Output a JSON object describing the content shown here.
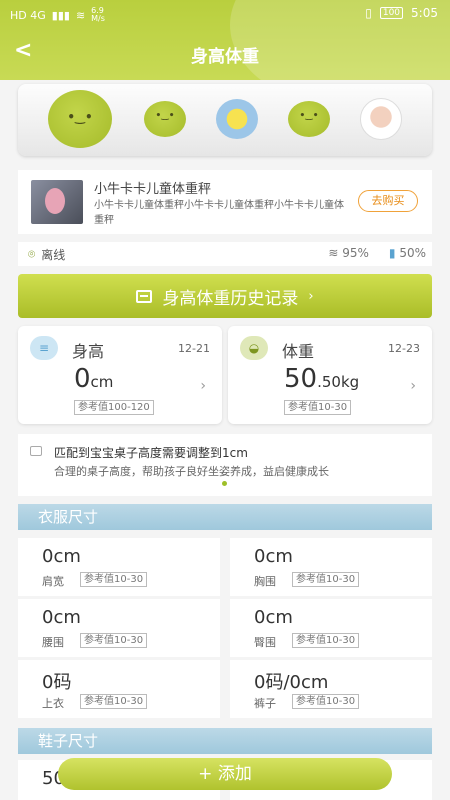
{
  "status_bar": {
    "network": "HD 4G",
    "speed_value": "6.9",
    "speed_unit": "M/s",
    "battery": "100",
    "time": "5:05"
  },
  "header": {
    "back_icon": "chevron-left-icon",
    "title": "身高体重"
  },
  "profiles": [
    "avatar-green-face-large",
    "avatar-green-face",
    "avatar-spongebob",
    "avatar-green-face",
    "avatar-girl-photo"
  ],
  "device": {
    "name": "小牛卡卡儿童体重秤",
    "desc": "小牛卡卡儿童体重秤小牛卡卡儿童体重秤小牛卡卡儿童体重秤",
    "buy_label": "去购买"
  },
  "connection": {
    "status": "离线",
    "wifi": "95%",
    "battery": "50%"
  },
  "history_button": "身高体重历史记录",
  "height": {
    "label": "身高",
    "date": "12-21",
    "value": "0",
    "unit": "cm",
    "ref": "参考值100-120"
  },
  "weight": {
    "label": "体重",
    "date": "12-23",
    "value": "50",
    "decimal": ".50",
    "unit": "kg",
    "ref": "参考值10-30"
  },
  "tip": {
    "title": "匹配到宝宝桌子高度需要调整到1cm",
    "text": "合理的桌子高度，帮助孩子良好坐姿养成，益启健康成长"
  },
  "clothes": {
    "title": "衣服尺寸",
    "items": [
      {
        "value": "0cm",
        "label": "肩宽",
        "ref": "参考值10-30"
      },
      {
        "value": "0cm",
        "label": "胸围",
        "ref": "参考值10-30"
      },
      {
        "value": "0cm",
        "label": "腰围",
        "ref": "参考值10-30"
      },
      {
        "value": "0cm",
        "label": "臀围",
        "ref": "参考值10-30"
      },
      {
        "value": "0码",
        "label": "上衣",
        "ref": "参考值10-30"
      },
      {
        "value": "0码/0cm",
        "label": "裤子",
        "ref": "参考值10-30"
      }
    ]
  },
  "shoes": {
    "title": "鞋子尺寸",
    "partial_value": "50"
  },
  "add_button": "+ 添加",
  "colors": {
    "accent": "#b9cf3e",
    "section": "#a7cde0",
    "buy": "#e88c16"
  }
}
